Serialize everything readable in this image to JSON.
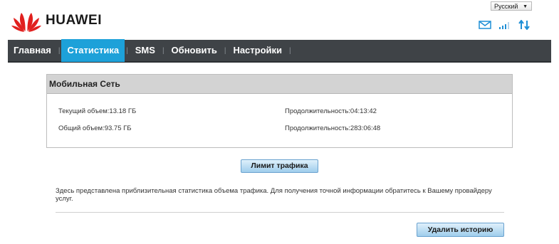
{
  "brand": {
    "name": "HUAWEI"
  },
  "language": {
    "selected": "Русский"
  },
  "nav": {
    "items": [
      {
        "label": "Главная"
      },
      {
        "label": "Статистика"
      },
      {
        "label": "SMS"
      },
      {
        "label": "Обновить"
      },
      {
        "label": "Настройки"
      }
    ],
    "active": "Статистика"
  },
  "panel": {
    "title": "Мобильная Сеть",
    "current_volume": "Текущий объем:13.18 ГБ",
    "current_duration": "Продолжительность:04:13:42",
    "total_volume": "Общий объем:93.75 ГБ",
    "total_duration": "Продолжительность:283:06:48"
  },
  "buttons": {
    "traffic_limit": "Лимит трафика",
    "delete_history": "Удалить историю"
  },
  "info_text": "Здесь представлена приблизительная статистика объема трафика. Для получения точной информации обратитесь к Вашему провайдеру услуг.",
  "icons": [
    "huawei-logo-icon",
    "envelope-icon",
    "signal-icon",
    "data-transfer-icon",
    "dropdown-arrow-icon"
  ],
  "colors": {
    "nav_bg": "#3f4347",
    "nav_active": "#1da1d9",
    "logo_red": "#e1201e",
    "icon_blue": "#1f8fd6"
  }
}
